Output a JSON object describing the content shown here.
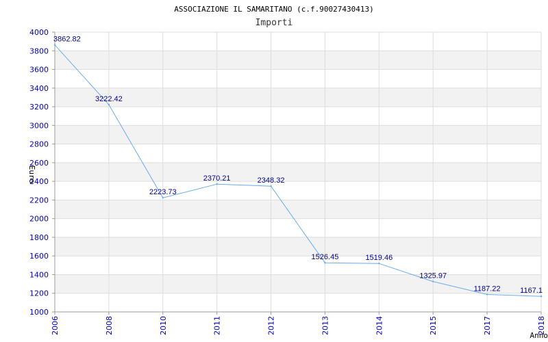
{
  "chart_data": {
    "type": "line",
    "title": "ASSOCIAZIONE IL SAMARITANO (c.f.90027430413)",
    "subtitle": "Importi",
    "xlabel": "Anno",
    "ylabel": "Euro",
    "categories": [
      "2006",
      "2008",
      "2010",
      "2011",
      "2012",
      "2013",
      "2014",
      "2015",
      "2017",
      "2018"
    ],
    "values": [
      3862.82,
      3222.42,
      2223.73,
      2370.21,
      2348.32,
      1526.45,
      1519.46,
      1325.97,
      1187.22,
      1167.1
    ],
    "value_labels": [
      "3862.82",
      "3222.42",
      "2223.73",
      "2370.21",
      "2348.32",
      "1526.45",
      "1519.46",
      "1325.97",
      "1187.22",
      "1167.1"
    ],
    "yticks": [
      "1000",
      "1200",
      "1400",
      "1600",
      "1800",
      "2000",
      "2200",
      "2400",
      "2600",
      "2800",
      "3000",
      "3200",
      "3400",
      "3600",
      "3800",
      "4000"
    ],
    "ylim": [
      1000,
      4000
    ],
    "grid": true,
    "colors": {
      "line": "#66aaee",
      "band": "#f2f2f2",
      "grid": "#dddddd",
      "axis": "#999999",
      "ticks": "#0000b0",
      "labels": "#000080"
    }
  }
}
